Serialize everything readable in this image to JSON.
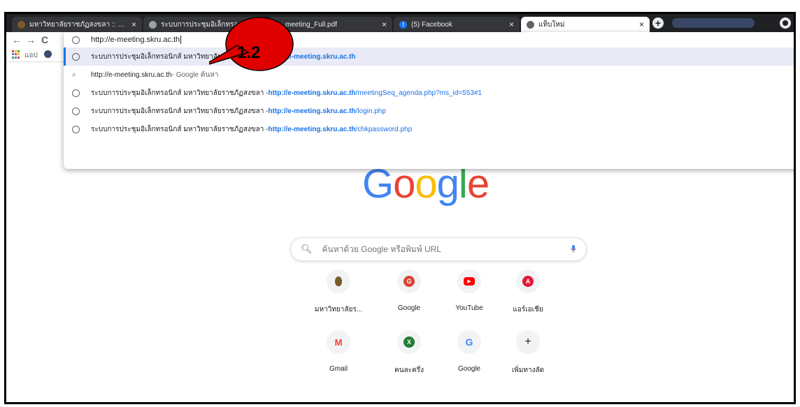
{
  "browser": {
    "tabs": [
      {
        "title": "มหาวิทยาลัยราชภัฏสงขลา :: Songkh",
        "close": "×",
        "favicon_color": "#7a5a2b"
      },
      {
        "title": "ระบบการประชุมอิเล็กทรอ",
        "close": "×",
        "favicon_color": "#9aa0a6"
      },
      {
        "title": "meeting_Full.pdf",
        "close": "×",
        "favicon_color": "#9aa0a6"
      },
      {
        "title": "(5) Facebook",
        "close": "×",
        "favicon_color": "#1877f2"
      },
      {
        "title": "แท็บใหม่",
        "close": "×",
        "favicon_color": "#5f6368"
      }
    ],
    "new_tab": "+",
    "back": "←",
    "forward": "→",
    "reload": "C"
  },
  "bookmarks_bar": {
    "apps_label": "แอป"
  },
  "omnibox": {
    "value": "http://e-meeting.skru.ac.th",
    "suggestions": [
      {
        "icon": "globe-icon",
        "prefix": "ระบบการประชุมอิเล็กทรอนิกส์ มหาวิทยาลัยราชภัฏสงขลา - ",
        "url_bold": "http://e-meeting.skru.ac.th",
        "url_rest": "",
        "selected": true,
        "remove": "×"
      },
      {
        "icon": "search-icon",
        "prefix": "http://e-meeting.skru.ac.th",
        "url_bold": "",
        "url_rest": "",
        "suffix": " - Google ค้นหา",
        "selected": false
      },
      {
        "icon": "globe-icon",
        "prefix": "ระบบการประชุมอิเล็กทรอนิกส์ มหาวิทยาลัยราชภัฏสงขลา - ",
        "url_bold": "http://e-meeting.skru.ac.th",
        "url_rest": "/meetingSeq_agenda.php?ms_id=553#1",
        "selected": false
      },
      {
        "icon": "globe-icon",
        "prefix": "ระบบการประชุมอิเล็กทรอนิกส์ มหาวิทยาลัยราชภัฏสงขลา - ",
        "url_bold": "http://e-meeting.skru.ac.th",
        "url_rest": "/login.php",
        "selected": false
      },
      {
        "icon": "globe-icon",
        "prefix": "ระบบการประชุมอิเล็กทรอนิกส์ มหาวิทยาลัยราชภัฏสงขลา - ",
        "url_bold": "http://e-meeting.skru.ac.th",
        "url_rest": "/chkpassword.php",
        "selected": false
      }
    ]
  },
  "newtab_page": {
    "logo": [
      "G",
      "o",
      "o",
      "g",
      "l",
      "e"
    ],
    "logo_colors": [
      "#4285f4",
      "#ea4335",
      "#fbbc05",
      "#4285f4",
      "#34a853",
      "#ea4335"
    ],
    "search_placeholder": "ค้นหาด้วย Google หรือพิมพ์ URL",
    "shortcuts": [
      {
        "label": "มหาวิทยาลัยร...",
        "glyph": "",
        "icon": "university-crest-icon",
        "color": "#7a5a2b"
      },
      {
        "label": "Google",
        "glyph": "G",
        "icon": "google-g-icon",
        "color": "#db4437"
      },
      {
        "label": "YouTube",
        "glyph": "▶",
        "icon": "youtube-icon",
        "color": "#ff0000"
      },
      {
        "label": "แอร์เอเชีย",
        "glyph": "A",
        "icon": "airasia-icon",
        "color": "#e31837"
      },
      {
        "label": "Gmail",
        "glyph": "M",
        "icon": "gmail-icon",
        "color": "#ea4335"
      },
      {
        "label": "คนละครึ่ง",
        "glyph": "X",
        "icon": "khonlakhrueng-icon",
        "color": "#1e7e34"
      },
      {
        "label": "Google",
        "glyph": "G",
        "icon": "google-g-icon",
        "color": "#4285f4"
      },
      {
        "label": "เพิ่มทางลัด",
        "glyph": "+",
        "icon": "add-shortcut-icon",
        "color": "#202124"
      }
    ]
  },
  "annotation": {
    "step_label": "1.2",
    "color": "#e00000"
  }
}
